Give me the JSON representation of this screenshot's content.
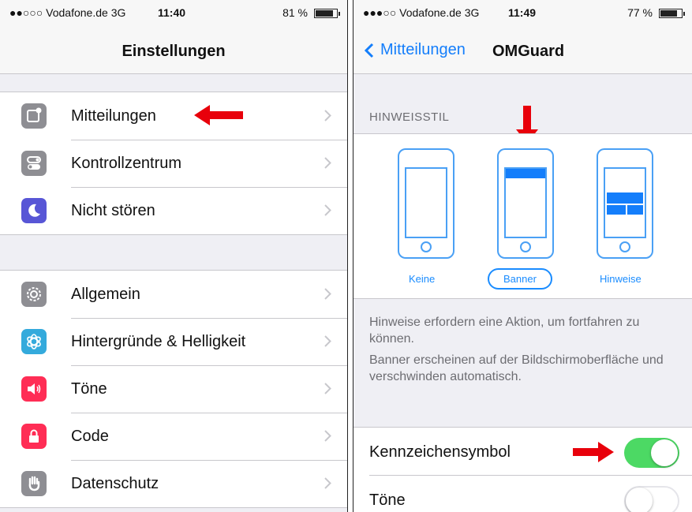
{
  "left": {
    "status": {
      "carrier": "●●○○○ Vodafone.de  3G",
      "time": "11:40",
      "battery": "81 %",
      "battery_level": 0.81
    },
    "nav_title": "Einstellungen",
    "group1": [
      {
        "label": "Mitteilungen",
        "icon": "notifications-icon",
        "color": "#8e8e93"
      },
      {
        "label": "Kontrollzentrum",
        "icon": "control-center-icon",
        "color": "#8e8e93"
      },
      {
        "label": "Nicht stören",
        "icon": "moon-icon",
        "color": "#5856d6"
      }
    ],
    "group2": [
      {
        "label": "Allgemein",
        "icon": "gear-icon",
        "color": "#8e8e93"
      },
      {
        "label": "Hintergründe & Helligkeit",
        "icon": "wallpaper-icon",
        "color": "#34aadc"
      },
      {
        "label": "Töne",
        "icon": "speaker-icon",
        "color": "#ff2d55"
      },
      {
        "label": "Code",
        "icon": "lock-icon",
        "color": "#ff2d55"
      },
      {
        "label": "Datenschutz",
        "icon": "hand-icon",
        "color": "#8e8e93"
      }
    ]
  },
  "right": {
    "status": {
      "carrier": "●●●○○ Vodafone.de  3G",
      "time": "11:49",
      "battery": "77 %",
      "battery_level": 0.77
    },
    "nav_back": "Mitteilungen",
    "nav_title": "OMGuard",
    "section_header": "HINWEISSTIL",
    "styles": [
      {
        "label": "Keine",
        "selected": false
      },
      {
        "label": "Banner",
        "selected": true
      },
      {
        "label": "Hinweise",
        "selected": false
      }
    ],
    "footnote1": "Hinweise erfordern eine Aktion, um fortfahren zu können.",
    "footnote2": "Banner erscheinen auf der Bildschirmoberfläche und verschwinden automatisch.",
    "settings": [
      {
        "label": "Kennzeichensymbol",
        "on": true
      },
      {
        "label": "Töne",
        "on": false
      }
    ]
  },
  "colors": {
    "accent": "#147efb",
    "toggle_on": "#4cd964",
    "arrow": "#e8000b"
  }
}
